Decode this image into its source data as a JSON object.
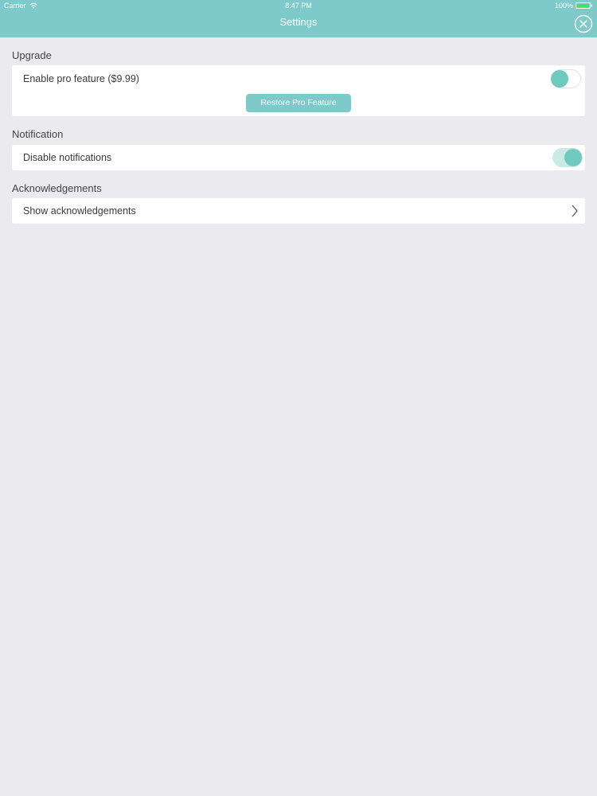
{
  "status_bar": {
    "carrier": "Carrier",
    "time": "8:47 PM",
    "battery": "100%",
    "icons": [
      "wifi-icon",
      "battery-icon"
    ]
  },
  "nav": {
    "title": "Settings",
    "close_icon": "close-icon"
  },
  "sections": {
    "upgrade": {
      "header": "Upgrade",
      "row_label": "Enable pro feature ($9.99)",
      "toggle_on": false,
      "restore_button": "Restore Pro Feature"
    },
    "notification": {
      "header": "Notification",
      "row_label": "Disable notifications",
      "toggle_on": true
    },
    "acknowledgements": {
      "header": "Acknowledgements",
      "row_label": "Show acknowledgements",
      "chevron_icon": "chevron-right-icon"
    }
  },
  "colors": {
    "accent": "#7ecaca",
    "toggle_knob": "#6fc9bd",
    "toggle_track_on": "#c9ebe4",
    "background": "#ebeaee"
  }
}
